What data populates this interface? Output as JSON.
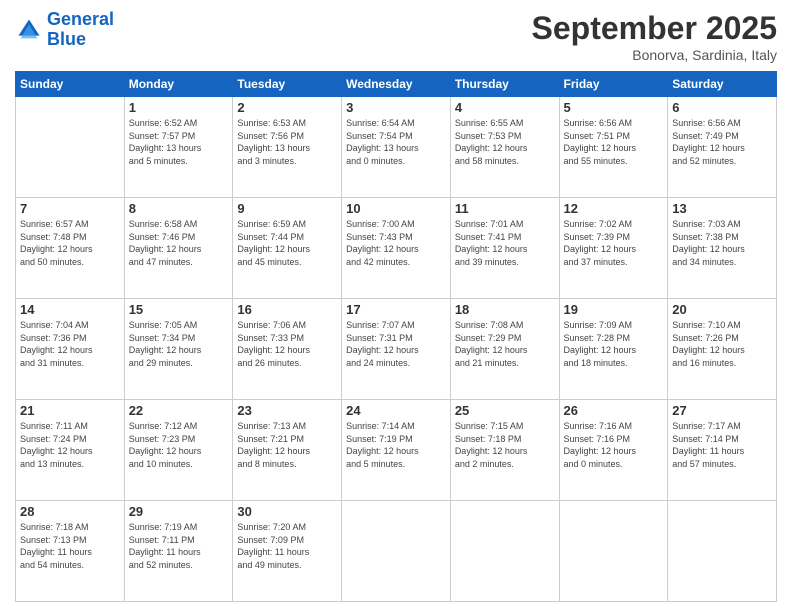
{
  "logo": {
    "line1": "General",
    "line2": "Blue"
  },
  "header": {
    "month": "September 2025",
    "location": "Bonorva, Sardinia, Italy"
  },
  "weekdays": [
    "Sunday",
    "Monday",
    "Tuesday",
    "Wednesday",
    "Thursday",
    "Friday",
    "Saturday"
  ],
  "weeks": [
    [
      {
        "day": "",
        "info": ""
      },
      {
        "day": "1",
        "info": "Sunrise: 6:52 AM\nSunset: 7:57 PM\nDaylight: 13 hours\nand 5 minutes."
      },
      {
        "day": "2",
        "info": "Sunrise: 6:53 AM\nSunset: 7:56 PM\nDaylight: 13 hours\nand 3 minutes."
      },
      {
        "day": "3",
        "info": "Sunrise: 6:54 AM\nSunset: 7:54 PM\nDaylight: 13 hours\nand 0 minutes."
      },
      {
        "day": "4",
        "info": "Sunrise: 6:55 AM\nSunset: 7:53 PM\nDaylight: 12 hours\nand 58 minutes."
      },
      {
        "day": "5",
        "info": "Sunrise: 6:56 AM\nSunset: 7:51 PM\nDaylight: 12 hours\nand 55 minutes."
      },
      {
        "day": "6",
        "info": "Sunrise: 6:56 AM\nSunset: 7:49 PM\nDaylight: 12 hours\nand 52 minutes."
      }
    ],
    [
      {
        "day": "7",
        "info": "Sunrise: 6:57 AM\nSunset: 7:48 PM\nDaylight: 12 hours\nand 50 minutes."
      },
      {
        "day": "8",
        "info": "Sunrise: 6:58 AM\nSunset: 7:46 PM\nDaylight: 12 hours\nand 47 minutes."
      },
      {
        "day": "9",
        "info": "Sunrise: 6:59 AM\nSunset: 7:44 PM\nDaylight: 12 hours\nand 45 minutes."
      },
      {
        "day": "10",
        "info": "Sunrise: 7:00 AM\nSunset: 7:43 PM\nDaylight: 12 hours\nand 42 minutes."
      },
      {
        "day": "11",
        "info": "Sunrise: 7:01 AM\nSunset: 7:41 PM\nDaylight: 12 hours\nand 39 minutes."
      },
      {
        "day": "12",
        "info": "Sunrise: 7:02 AM\nSunset: 7:39 PM\nDaylight: 12 hours\nand 37 minutes."
      },
      {
        "day": "13",
        "info": "Sunrise: 7:03 AM\nSunset: 7:38 PM\nDaylight: 12 hours\nand 34 minutes."
      }
    ],
    [
      {
        "day": "14",
        "info": "Sunrise: 7:04 AM\nSunset: 7:36 PM\nDaylight: 12 hours\nand 31 minutes."
      },
      {
        "day": "15",
        "info": "Sunrise: 7:05 AM\nSunset: 7:34 PM\nDaylight: 12 hours\nand 29 minutes."
      },
      {
        "day": "16",
        "info": "Sunrise: 7:06 AM\nSunset: 7:33 PM\nDaylight: 12 hours\nand 26 minutes."
      },
      {
        "day": "17",
        "info": "Sunrise: 7:07 AM\nSunset: 7:31 PM\nDaylight: 12 hours\nand 24 minutes."
      },
      {
        "day": "18",
        "info": "Sunrise: 7:08 AM\nSunset: 7:29 PM\nDaylight: 12 hours\nand 21 minutes."
      },
      {
        "day": "19",
        "info": "Sunrise: 7:09 AM\nSunset: 7:28 PM\nDaylight: 12 hours\nand 18 minutes."
      },
      {
        "day": "20",
        "info": "Sunrise: 7:10 AM\nSunset: 7:26 PM\nDaylight: 12 hours\nand 16 minutes."
      }
    ],
    [
      {
        "day": "21",
        "info": "Sunrise: 7:11 AM\nSunset: 7:24 PM\nDaylight: 12 hours\nand 13 minutes."
      },
      {
        "day": "22",
        "info": "Sunrise: 7:12 AM\nSunset: 7:23 PM\nDaylight: 12 hours\nand 10 minutes."
      },
      {
        "day": "23",
        "info": "Sunrise: 7:13 AM\nSunset: 7:21 PM\nDaylight: 12 hours\nand 8 minutes."
      },
      {
        "day": "24",
        "info": "Sunrise: 7:14 AM\nSunset: 7:19 PM\nDaylight: 12 hours\nand 5 minutes."
      },
      {
        "day": "25",
        "info": "Sunrise: 7:15 AM\nSunset: 7:18 PM\nDaylight: 12 hours\nand 2 minutes."
      },
      {
        "day": "26",
        "info": "Sunrise: 7:16 AM\nSunset: 7:16 PM\nDaylight: 12 hours\nand 0 minutes."
      },
      {
        "day": "27",
        "info": "Sunrise: 7:17 AM\nSunset: 7:14 PM\nDaylight: 11 hours\nand 57 minutes."
      }
    ],
    [
      {
        "day": "28",
        "info": "Sunrise: 7:18 AM\nSunset: 7:13 PM\nDaylight: 11 hours\nand 54 minutes."
      },
      {
        "day": "29",
        "info": "Sunrise: 7:19 AM\nSunset: 7:11 PM\nDaylight: 11 hours\nand 52 minutes."
      },
      {
        "day": "30",
        "info": "Sunrise: 7:20 AM\nSunset: 7:09 PM\nDaylight: 11 hours\nand 49 minutes."
      },
      {
        "day": "",
        "info": ""
      },
      {
        "day": "",
        "info": ""
      },
      {
        "day": "",
        "info": ""
      },
      {
        "day": "",
        "info": ""
      }
    ]
  ]
}
